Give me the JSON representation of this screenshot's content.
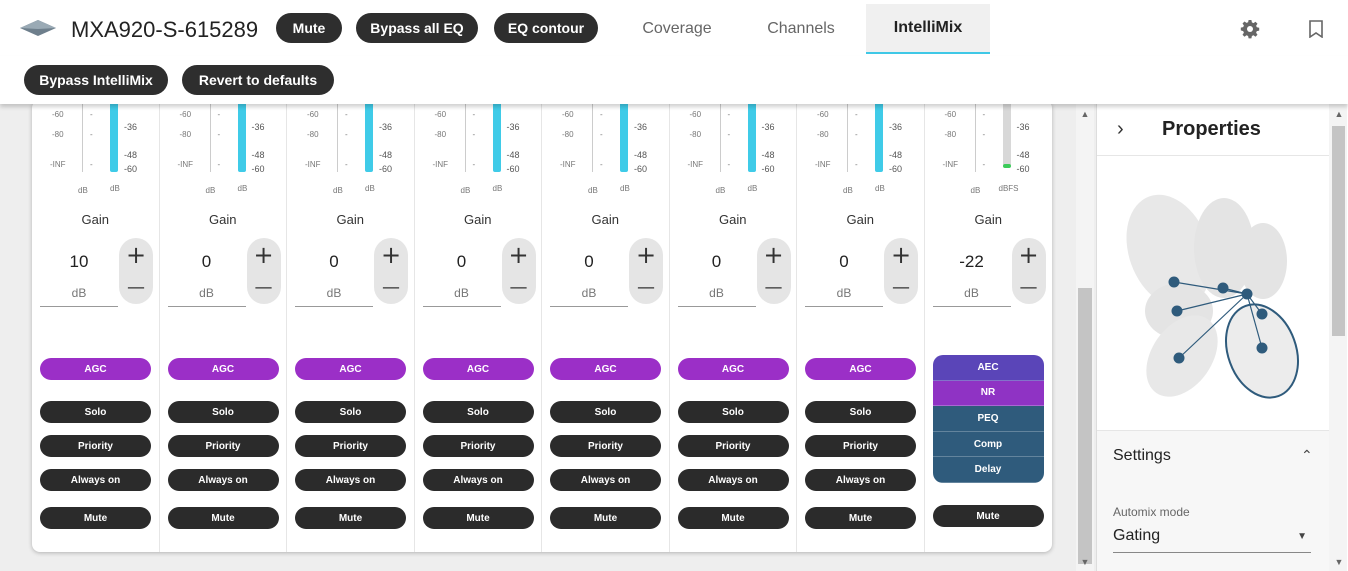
{
  "header": {
    "device_name": "MXA920-S-615289",
    "buttons": {
      "mute": "Mute",
      "bypass_all_eq": "Bypass all EQ",
      "eq_contour": "EQ contour"
    },
    "tabs": [
      {
        "label": "Coverage",
        "active": false
      },
      {
        "label": "Channels",
        "active": false
      },
      {
        "label": "IntelliMix",
        "active": true
      }
    ],
    "icons": [
      "gear-icon",
      "bookmark-icon"
    ]
  },
  "toolbar": {
    "bypass_intellimix": "Bypass IntelliMix",
    "revert_to_defaults": "Revert to defaults"
  },
  "meter_labels": {
    "left": [
      "-60",
      "-80",
      "-INF"
    ],
    "right": [
      "-36",
      "-48",
      "-60"
    ],
    "unit_left": "dB",
    "unit_right": "dB",
    "unit_right_last": "dBFS"
  },
  "channels": [
    {
      "gain_label": "Gain",
      "gain_value": "10",
      "gain_unit": "dB",
      "agc": "AGC",
      "solo": "Solo",
      "priority": "Priority",
      "always_on": "Always on",
      "mute": "Mute"
    },
    {
      "gain_label": "Gain",
      "gain_value": "0",
      "gain_unit": "dB",
      "agc": "AGC",
      "solo": "Solo",
      "priority": "Priority",
      "always_on": "Always on",
      "mute": "Mute"
    },
    {
      "gain_label": "Gain",
      "gain_value": "0",
      "gain_unit": "dB",
      "agc": "AGC",
      "solo": "Solo",
      "priority": "Priority",
      "always_on": "Always on",
      "mute": "Mute"
    },
    {
      "gain_label": "Gain",
      "gain_value": "0",
      "gain_unit": "dB",
      "agc": "AGC",
      "solo": "Solo",
      "priority": "Priority",
      "always_on": "Always on",
      "mute": "Mute"
    },
    {
      "gain_label": "Gain",
      "gain_value": "0",
      "gain_unit": "dB",
      "agc": "AGC",
      "solo": "Solo",
      "priority": "Priority",
      "always_on": "Always on",
      "mute": "Mute"
    },
    {
      "gain_label": "Gain",
      "gain_value": "0",
      "gain_unit": "dB",
      "agc": "AGC",
      "solo": "Solo",
      "priority": "Priority",
      "always_on": "Always on",
      "mute": "Mute"
    },
    {
      "gain_label": "Gain",
      "gain_value": "0",
      "gain_unit": "dB",
      "agc": "AGC",
      "solo": "Solo",
      "priority": "Priority",
      "always_on": "Always on",
      "mute": "Mute"
    }
  ],
  "output_channel": {
    "gain_label": "Gain",
    "gain_value": "-22",
    "gain_unit": "dB",
    "dsp_blocks": [
      {
        "label": "AEC",
        "color": "#5a45b8"
      },
      {
        "label": "NR",
        "color": "#8f33c4"
      },
      {
        "label": "PEQ",
        "color": "#2f5b7c"
      },
      {
        "label": "Comp",
        "color": "#2f5b7c"
      },
      {
        "label": "Delay",
        "color": "#2f5b7c"
      }
    ],
    "mute": "Mute"
  },
  "properties": {
    "title": "Properties",
    "settings_title": "Settings",
    "automix_label": "Automix mode",
    "automix_value": "Gating"
  },
  "colors": {
    "meter_cyan": "#3fcbe8",
    "agc_purple": "#9b2fc7",
    "dark_button": "#2b2b2b",
    "tab_underline": "#3fc8e6"
  }
}
